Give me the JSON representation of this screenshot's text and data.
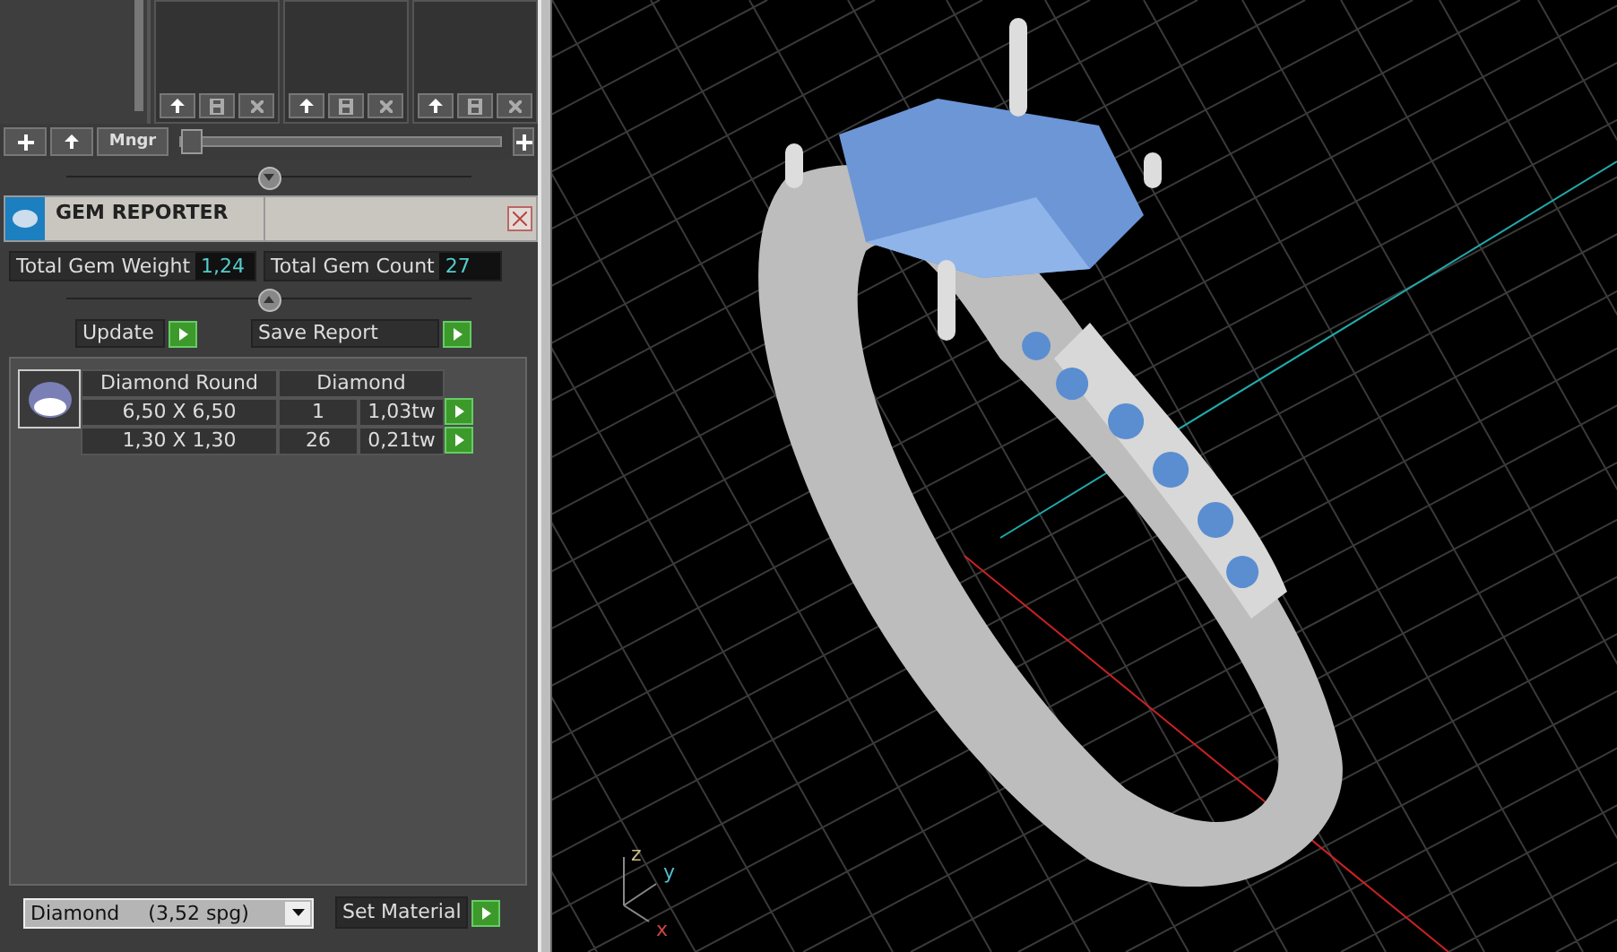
{
  "toolbar": {
    "buttons": [
      {
        "kind": "plus"
      },
      {
        "kind": "up"
      },
      {
        "kind": "text",
        "label": "Mngr"
      }
    ],
    "slider": {
      "level": 0
    }
  },
  "gem_reporter": {
    "title": "GEM REPORTER",
    "totals": [
      {
        "label": "Total Gem Weight",
        "value": "1,24"
      },
      {
        "label": "Total Gem Count",
        "value": "27"
      }
    ],
    "actions": [
      {
        "label": "Update"
      },
      {
        "label": "Save Report"
      }
    ],
    "table": {
      "columns": [
        "Diamond Round",
        "Diamond"
      ],
      "rows": [
        {
          "size": "6,50 X 6,50",
          "count": "1",
          "weight": "1,03tw"
        },
        {
          "size": "1,30 X 1,30",
          "count": "26",
          "weight": "0,21tw"
        }
      ]
    },
    "material": {
      "name": "Diamond",
      "density": "(3,52 spg)"
    },
    "set_material": "Set Material"
  },
  "viewport": {
    "axes": [
      "z",
      "y",
      "x"
    ]
  }
}
